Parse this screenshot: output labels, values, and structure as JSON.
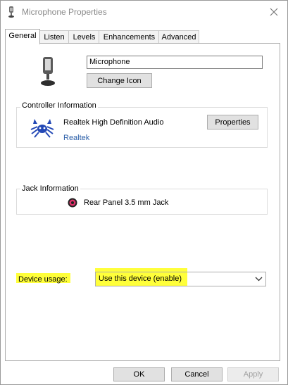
{
  "window": {
    "title": "Microphone Properties"
  },
  "tabs": [
    {
      "label": "General",
      "active": true
    },
    {
      "label": "Listen"
    },
    {
      "label": "Levels"
    },
    {
      "label": "Enhancements"
    },
    {
      "label": "Advanced"
    }
  ],
  "general": {
    "device_name_value": "Microphone",
    "change_icon_label": "Change Icon",
    "controller": {
      "group_label": "Controller Information",
      "device": "Realtek High Definition Audio",
      "vendor_link": "Realtek",
      "properties_label": "Properties"
    },
    "jack": {
      "group_label": "Jack Information",
      "item": "Rear Panel 3.5 mm Jack",
      "color": "#e0316a"
    },
    "usage": {
      "label": "Device usage:",
      "selected": "Use this device (enable)",
      "highlight_color": "#ffff3a"
    }
  },
  "footer": {
    "ok_label": "OK",
    "cancel_label": "Cancel",
    "apply_label": "Apply",
    "apply_enabled": false
  }
}
